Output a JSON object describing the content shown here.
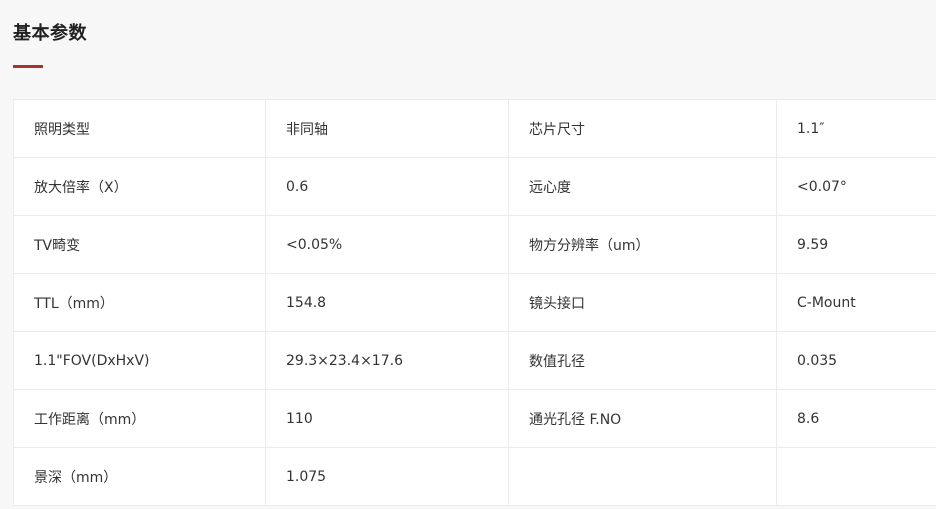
{
  "section": {
    "title": "基本参数",
    "accent_color": "#a8322d"
  },
  "params": {
    "rows": [
      [
        "照明类型",
        "非同轴",
        "芯片尺寸",
        "1.1″"
      ],
      [
        "放大倍率（X）",
        "0.6",
        "远心度",
        "<0.07°"
      ],
      [
        "TV畸变",
        "<0.05%",
        "物方分辨率（um）",
        "9.59"
      ],
      [
        "TTL（mm）",
        "154.8",
        "镜头接口",
        "C-Mount"
      ],
      [
        "1.1\"FOV(DxHxV)",
        "29.3×23.4×17.6",
        "数值孔径",
        "0.035"
      ],
      [
        "工作距离（mm）",
        "110",
        "通光孔径 F.NO",
        "8.6"
      ],
      [
        "景深（mm）",
        "1.075",
        "",
        ""
      ]
    ]
  }
}
